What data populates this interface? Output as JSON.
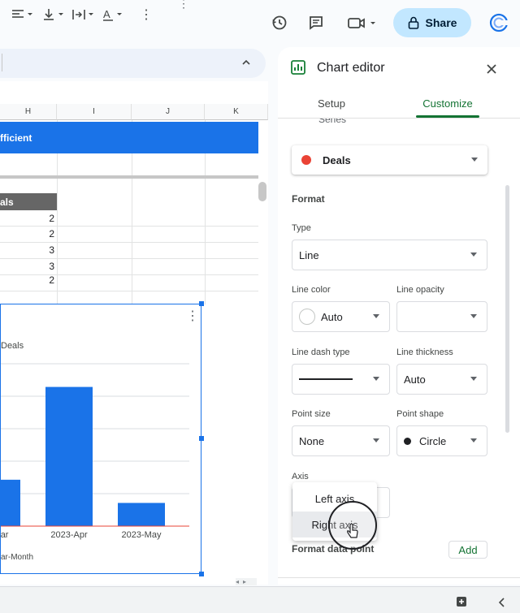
{
  "header": {
    "share_label": "Share"
  },
  "sheet": {
    "columns": [
      "H",
      "I",
      "J",
      "K"
    ],
    "band_text": "fficient",
    "table_header": "als",
    "values": [
      "2",
      "2",
      "3",
      "3",
      "2"
    ]
  },
  "chart_data": {
    "type": "bar",
    "legend": "Deals",
    "categories": [
      "Mar",
      "2023-Apr",
      "2023-May"
    ],
    "values": [
      2,
      6,
      1
    ],
    "xlabel": "ar-Month",
    "ylim": [
      0,
      7
    ],
    "colors": {
      "bar": "#1a73e8"
    }
  },
  "panel": {
    "title": "Chart editor",
    "tabs": [
      {
        "label": "Setup",
        "active": false
      },
      {
        "label": "Customize",
        "active": true
      }
    ],
    "cut_label": "Series",
    "series_select": "Deals",
    "series_color": "#ea4335",
    "format_title": "Format",
    "type_label": "Type",
    "type_value": "Line",
    "line_color_label": "Line color",
    "line_color_value": "Auto",
    "line_opacity_label": "Line opacity",
    "line_opacity_value": "",
    "line_dash_label": "Line dash type",
    "line_thickness_label": "Line thickness",
    "line_thickness_value": "Auto",
    "point_size_label": "Point size",
    "point_size_value": "None",
    "point_shape_label": "Point shape",
    "point_shape_value": "Circle",
    "axis_label": "Axis",
    "axis_options": [
      "Left axis",
      "Right axis"
    ],
    "format_point_label": "Format data point",
    "add_label": "Add"
  },
  "colors": {
    "accent": "#1a73e8",
    "active_tab": "#137333",
    "share_bg": "#c2e7ff"
  }
}
